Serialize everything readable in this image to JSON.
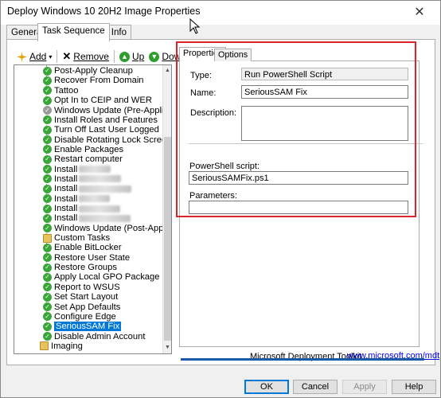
{
  "window": {
    "title": "Deploy Windows 10 20H2 Image Properties",
    "close_glyph": "✕"
  },
  "tabs": [
    {
      "label": "General"
    },
    {
      "label": "Task Sequence"
    },
    {
      "label": "OS Info"
    }
  ],
  "toolbar": {
    "add_label": "Add",
    "add_underline": "A",
    "remove_label": "Remove",
    "remove_underline": "R",
    "up_label": "Up",
    "up_underline": "U",
    "down_label": "Down",
    "down_underline": "D",
    "icons": {
      "add": "sparkle-icon",
      "remove": "x-icon",
      "up": "green-up-arrow-icon",
      "down": "green-down-arrow-icon"
    }
  },
  "tree": {
    "items": [
      {
        "label": "Post-Apply Cleanup",
        "icon": "check"
      },
      {
        "label": "Recover From Domain",
        "icon": "check"
      },
      {
        "label": "Tattoo",
        "icon": "check"
      },
      {
        "label": "Opt In to CEIP and WER",
        "icon": "check"
      },
      {
        "label": "Windows Update (Pre-Application Inst",
        "icon": "gray"
      },
      {
        "label": "Install Roles and Features",
        "icon": "check"
      },
      {
        "label": "Turn Off Last User Logged In",
        "icon": "check"
      },
      {
        "label": "Disable Rotating Lock Screen",
        "icon": "check"
      },
      {
        "label": "Enable Packages",
        "icon": "check"
      },
      {
        "label": "Restart computer",
        "icon": "check"
      },
      {
        "label": "Install",
        "icon": "check",
        "redacted": true
      },
      {
        "label": "Install",
        "icon": "check",
        "redacted": true
      },
      {
        "label": "Install",
        "icon": "check",
        "redacted": true
      },
      {
        "label": "Install",
        "icon": "check",
        "redacted": true
      },
      {
        "label": "Install",
        "icon": "check",
        "redacted": true
      },
      {
        "label": "Install",
        "icon": "check",
        "redacted": true
      },
      {
        "label": "Windows Update (Post-Application Ins",
        "icon": "check"
      },
      {
        "label": "Custom Tasks",
        "icon": "folder"
      },
      {
        "label": "Enable BitLocker",
        "icon": "check"
      },
      {
        "label": "Restore User State",
        "icon": "check"
      },
      {
        "label": "Restore Groups",
        "icon": "check"
      },
      {
        "label": "Apply Local GPO Package",
        "icon": "check"
      },
      {
        "label": "Report to WSUS",
        "icon": "check"
      },
      {
        "label": "Set Start Layout",
        "icon": "check"
      },
      {
        "label": "Set App Defaults",
        "icon": "check"
      },
      {
        "label": "Configure Edge",
        "icon": "check"
      },
      {
        "label": "SeriousSAM Fix",
        "icon": "check",
        "selected": true
      },
      {
        "label": "Disable Admin Account",
        "icon": "check"
      },
      {
        "label": "Imaging",
        "icon": "folder"
      }
    ]
  },
  "right": {
    "tabs": [
      {
        "label": "Properties"
      },
      {
        "label": "Options"
      }
    ],
    "type_label": "Type:",
    "type_value": "Run PowerShell Script",
    "name_label": "Name:",
    "name_value": "SeriousSAM Fix",
    "description_label": "Description:",
    "description_value": "",
    "script_label": "PowerShell script:",
    "script_value": "SeriousSAMFix.ps1",
    "parameters_label": "Parameters:",
    "parameters_value": ""
  },
  "footer": {
    "toolkit": "Microsoft Deployment Toolkit",
    "link": "www.microsoft.com/mdt"
  },
  "buttons": {
    "ok": "OK",
    "cancel": "Cancel",
    "apply": "Apply",
    "help": "Help"
  },
  "colors": {
    "highlight": "#d9262c",
    "selection": "#0078d7",
    "accent_line": "#1a5aa6"
  }
}
